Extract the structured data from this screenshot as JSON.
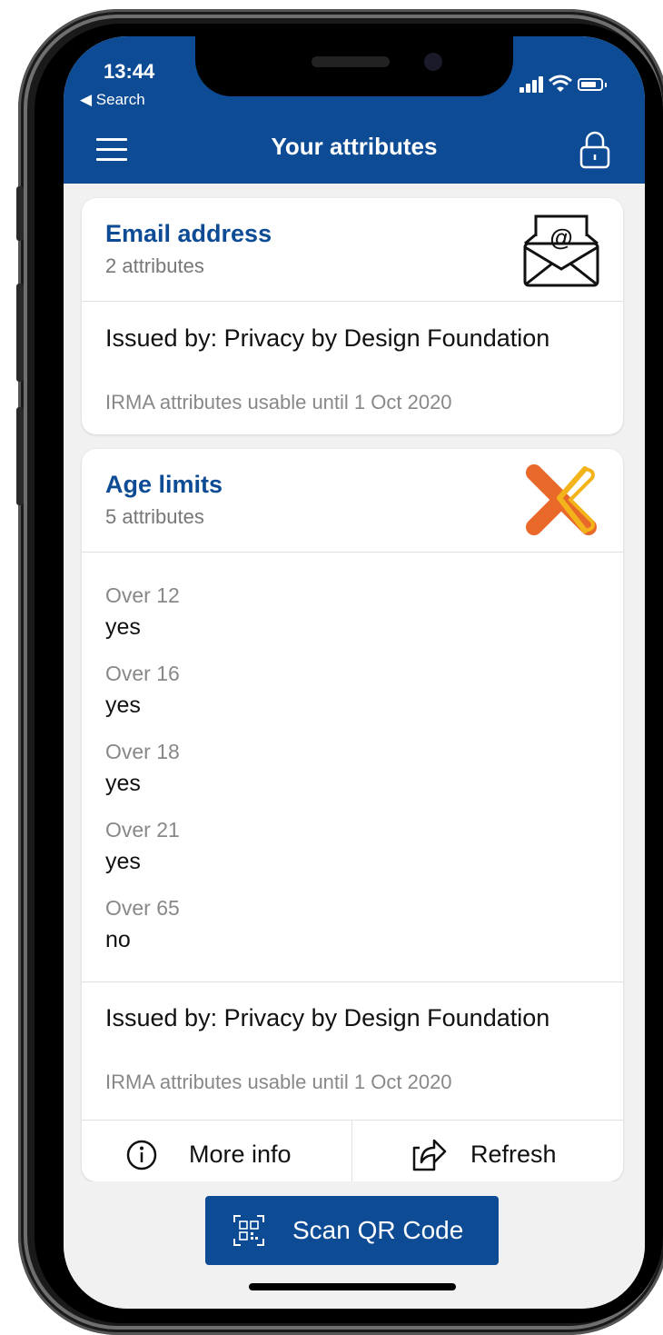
{
  "status_bar": {
    "time": "13:44",
    "back_label": "◀ Search"
  },
  "header": {
    "title": "Your attributes"
  },
  "cards": [
    {
      "title": "Email address",
      "subtitle": "2 attributes",
      "icon": "email-envelope-icon",
      "issued_by": "Issued by: Privacy by Design Foundation",
      "validity": "IRMA attributes usable until 1 Oct 2020"
    },
    {
      "title": "Age limits",
      "subtitle": "5 attributes",
      "icon": "age-limits-logo-icon",
      "attributes": [
        {
          "label": "Over 12",
          "value": "yes"
        },
        {
          "label": "Over 16",
          "value": "yes"
        },
        {
          "label": "Over 18",
          "value": "yes"
        },
        {
          "label": "Over 21",
          "value": "yes"
        },
        {
          "label": "Over 65",
          "value": "no"
        }
      ],
      "issued_by": "Issued by: Privacy by Design Foundation",
      "validity": "IRMA attributes usable until 1 Oct 2020",
      "actions": {
        "more_info": "More info",
        "refresh": "Refresh"
      }
    }
  ],
  "scan_button": {
    "label": "Scan QR Code",
    "icon": "qr-code-icon"
  },
  "colors": {
    "primary": "#0e4b95",
    "background": "#f1f1f1",
    "accent_orange": "#e8692a",
    "accent_yellow": "#f3b41b"
  }
}
